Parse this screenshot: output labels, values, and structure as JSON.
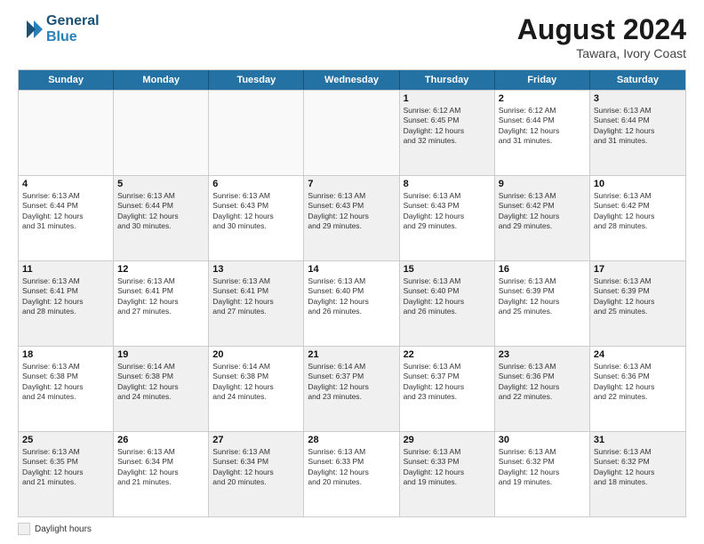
{
  "header": {
    "logo_line1": "General",
    "logo_line2": "Blue",
    "month_title": "August 2024",
    "subtitle": "Tawara, Ivory Coast"
  },
  "legend": {
    "box_label": "Daylight hours"
  },
  "days_of_week": [
    "Sunday",
    "Monday",
    "Tuesday",
    "Wednesday",
    "Thursday",
    "Friday",
    "Saturday"
  ],
  "weeks": [
    {
      "cells": [
        {
          "day": "",
          "info": "",
          "empty": true
        },
        {
          "day": "",
          "info": "",
          "empty": true
        },
        {
          "day": "",
          "info": "",
          "empty": true
        },
        {
          "day": "",
          "info": "",
          "empty": true
        },
        {
          "day": "1",
          "info": "Sunrise: 6:12 AM\nSunset: 6:45 PM\nDaylight: 12 hours\nand 32 minutes.",
          "shaded": true
        },
        {
          "day": "2",
          "info": "Sunrise: 6:12 AM\nSunset: 6:44 PM\nDaylight: 12 hours\nand 31 minutes.",
          "shaded": false
        },
        {
          "day": "3",
          "info": "Sunrise: 6:13 AM\nSunset: 6:44 PM\nDaylight: 12 hours\nand 31 minutes.",
          "shaded": true
        }
      ]
    },
    {
      "cells": [
        {
          "day": "4",
          "info": "Sunrise: 6:13 AM\nSunset: 6:44 PM\nDaylight: 12 hours\nand 31 minutes.",
          "shaded": false
        },
        {
          "day": "5",
          "info": "Sunrise: 6:13 AM\nSunset: 6:44 PM\nDaylight: 12 hours\nand 30 minutes.",
          "shaded": true
        },
        {
          "day": "6",
          "info": "Sunrise: 6:13 AM\nSunset: 6:43 PM\nDaylight: 12 hours\nand 30 minutes.",
          "shaded": false
        },
        {
          "day": "7",
          "info": "Sunrise: 6:13 AM\nSunset: 6:43 PM\nDaylight: 12 hours\nand 29 minutes.",
          "shaded": true
        },
        {
          "day": "8",
          "info": "Sunrise: 6:13 AM\nSunset: 6:43 PM\nDaylight: 12 hours\nand 29 minutes.",
          "shaded": false
        },
        {
          "day": "9",
          "info": "Sunrise: 6:13 AM\nSunset: 6:42 PM\nDaylight: 12 hours\nand 29 minutes.",
          "shaded": true
        },
        {
          "day": "10",
          "info": "Sunrise: 6:13 AM\nSunset: 6:42 PM\nDaylight: 12 hours\nand 28 minutes.",
          "shaded": false
        }
      ]
    },
    {
      "cells": [
        {
          "day": "11",
          "info": "Sunrise: 6:13 AM\nSunset: 6:41 PM\nDaylight: 12 hours\nand 28 minutes.",
          "shaded": true
        },
        {
          "day": "12",
          "info": "Sunrise: 6:13 AM\nSunset: 6:41 PM\nDaylight: 12 hours\nand 27 minutes.",
          "shaded": false
        },
        {
          "day": "13",
          "info": "Sunrise: 6:13 AM\nSunset: 6:41 PM\nDaylight: 12 hours\nand 27 minutes.",
          "shaded": true
        },
        {
          "day": "14",
          "info": "Sunrise: 6:13 AM\nSunset: 6:40 PM\nDaylight: 12 hours\nand 26 minutes.",
          "shaded": false
        },
        {
          "day": "15",
          "info": "Sunrise: 6:13 AM\nSunset: 6:40 PM\nDaylight: 12 hours\nand 26 minutes.",
          "shaded": true
        },
        {
          "day": "16",
          "info": "Sunrise: 6:13 AM\nSunset: 6:39 PM\nDaylight: 12 hours\nand 25 minutes.",
          "shaded": false
        },
        {
          "day": "17",
          "info": "Sunrise: 6:13 AM\nSunset: 6:39 PM\nDaylight: 12 hours\nand 25 minutes.",
          "shaded": true
        }
      ]
    },
    {
      "cells": [
        {
          "day": "18",
          "info": "Sunrise: 6:13 AM\nSunset: 6:38 PM\nDaylight: 12 hours\nand 24 minutes.",
          "shaded": false
        },
        {
          "day": "19",
          "info": "Sunrise: 6:14 AM\nSunset: 6:38 PM\nDaylight: 12 hours\nand 24 minutes.",
          "shaded": true
        },
        {
          "day": "20",
          "info": "Sunrise: 6:14 AM\nSunset: 6:38 PM\nDaylight: 12 hours\nand 24 minutes.",
          "shaded": false
        },
        {
          "day": "21",
          "info": "Sunrise: 6:14 AM\nSunset: 6:37 PM\nDaylight: 12 hours\nand 23 minutes.",
          "shaded": true
        },
        {
          "day": "22",
          "info": "Sunrise: 6:13 AM\nSunset: 6:37 PM\nDaylight: 12 hours\nand 23 minutes.",
          "shaded": false
        },
        {
          "day": "23",
          "info": "Sunrise: 6:13 AM\nSunset: 6:36 PM\nDaylight: 12 hours\nand 22 minutes.",
          "shaded": true
        },
        {
          "day": "24",
          "info": "Sunrise: 6:13 AM\nSunset: 6:36 PM\nDaylight: 12 hours\nand 22 minutes.",
          "shaded": false
        }
      ]
    },
    {
      "cells": [
        {
          "day": "25",
          "info": "Sunrise: 6:13 AM\nSunset: 6:35 PM\nDaylight: 12 hours\nand 21 minutes.",
          "shaded": true
        },
        {
          "day": "26",
          "info": "Sunrise: 6:13 AM\nSunset: 6:34 PM\nDaylight: 12 hours\nand 21 minutes.",
          "shaded": false
        },
        {
          "day": "27",
          "info": "Sunrise: 6:13 AM\nSunset: 6:34 PM\nDaylight: 12 hours\nand 20 minutes.",
          "shaded": true
        },
        {
          "day": "28",
          "info": "Sunrise: 6:13 AM\nSunset: 6:33 PM\nDaylight: 12 hours\nand 20 minutes.",
          "shaded": false
        },
        {
          "day": "29",
          "info": "Sunrise: 6:13 AM\nSunset: 6:33 PM\nDaylight: 12 hours\nand 19 minutes.",
          "shaded": true
        },
        {
          "day": "30",
          "info": "Sunrise: 6:13 AM\nSunset: 6:32 PM\nDaylight: 12 hours\nand 19 minutes.",
          "shaded": false
        },
        {
          "day": "31",
          "info": "Sunrise: 6:13 AM\nSunset: 6:32 PM\nDaylight: 12 hours\nand 18 minutes.",
          "shaded": true
        }
      ]
    }
  ]
}
